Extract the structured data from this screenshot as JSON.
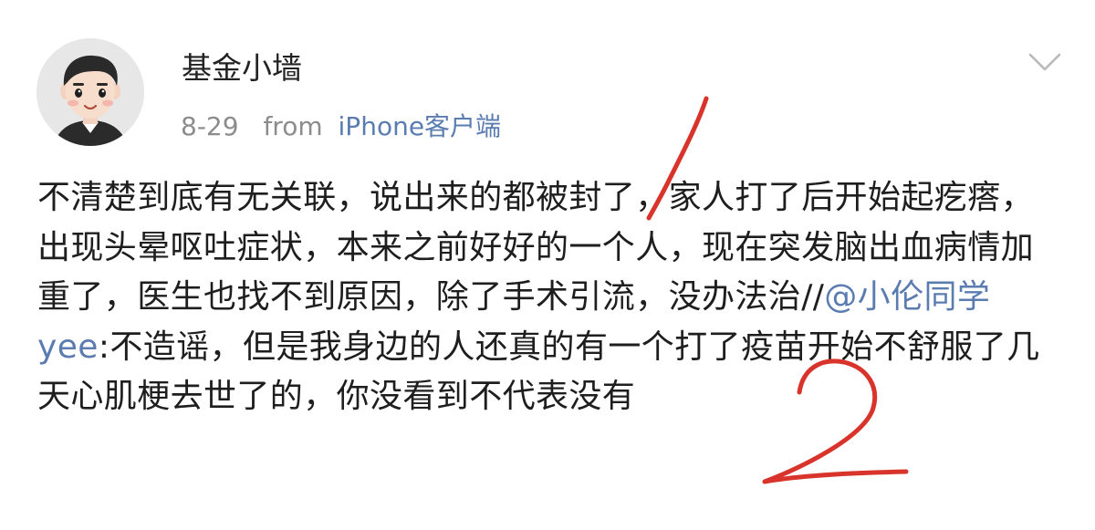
{
  "post": {
    "username": "基金小墙",
    "date": "8-29",
    "from_label": "from",
    "device": "iPhone客户端",
    "text_before": "不清楚到底有无关联，说出来的都被封了，家人打了后开始起疙瘩，出现头晕呕吐症状，本来之前好好的一个人，现在突发脑出血病情加重了，医生也找不到原因，除了手术引流，没办法治//",
    "mention": "@小伦同学yee",
    "text_after": ":不造谣，但是我身边的人还真的有一个打了疫苗开始不舒服了几天心肌梗去世了的，你没看到不代表没有"
  },
  "icons": {
    "menu": "chevron-down-icon",
    "avatar": "cartoon-avatar"
  },
  "annotations": {
    "mark_1": "1",
    "mark_2": "2",
    "color": "#d9342b"
  },
  "colors": {
    "link": "#5b7cb1",
    "meta": "#8c8c8c",
    "text": "#1e1e1e"
  }
}
